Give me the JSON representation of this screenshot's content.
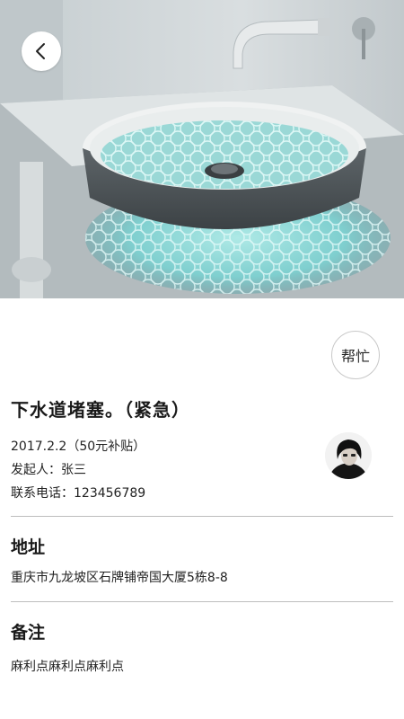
{
  "header": {
    "back_icon": "chevron-left-icon"
  },
  "task": {
    "help_label": "帮忙",
    "title": "下水道堵塞。（紧急）",
    "date_reward": "2017.2.2（50元补贴）",
    "initiator": "发起人：张三",
    "phone": "联系电话：123456789"
  },
  "address": {
    "heading": "地址",
    "text": "重庆市九龙坡区石牌铺帝国大厦5栋8-8"
  },
  "notes": {
    "heading": "备注",
    "text": "麻利点麻利点麻利点"
  },
  "colors": {
    "background": "#ffffff",
    "divider": "#bdbdbd",
    "text": "#1a1a1a",
    "basin_glow": "#8fd8d6"
  }
}
